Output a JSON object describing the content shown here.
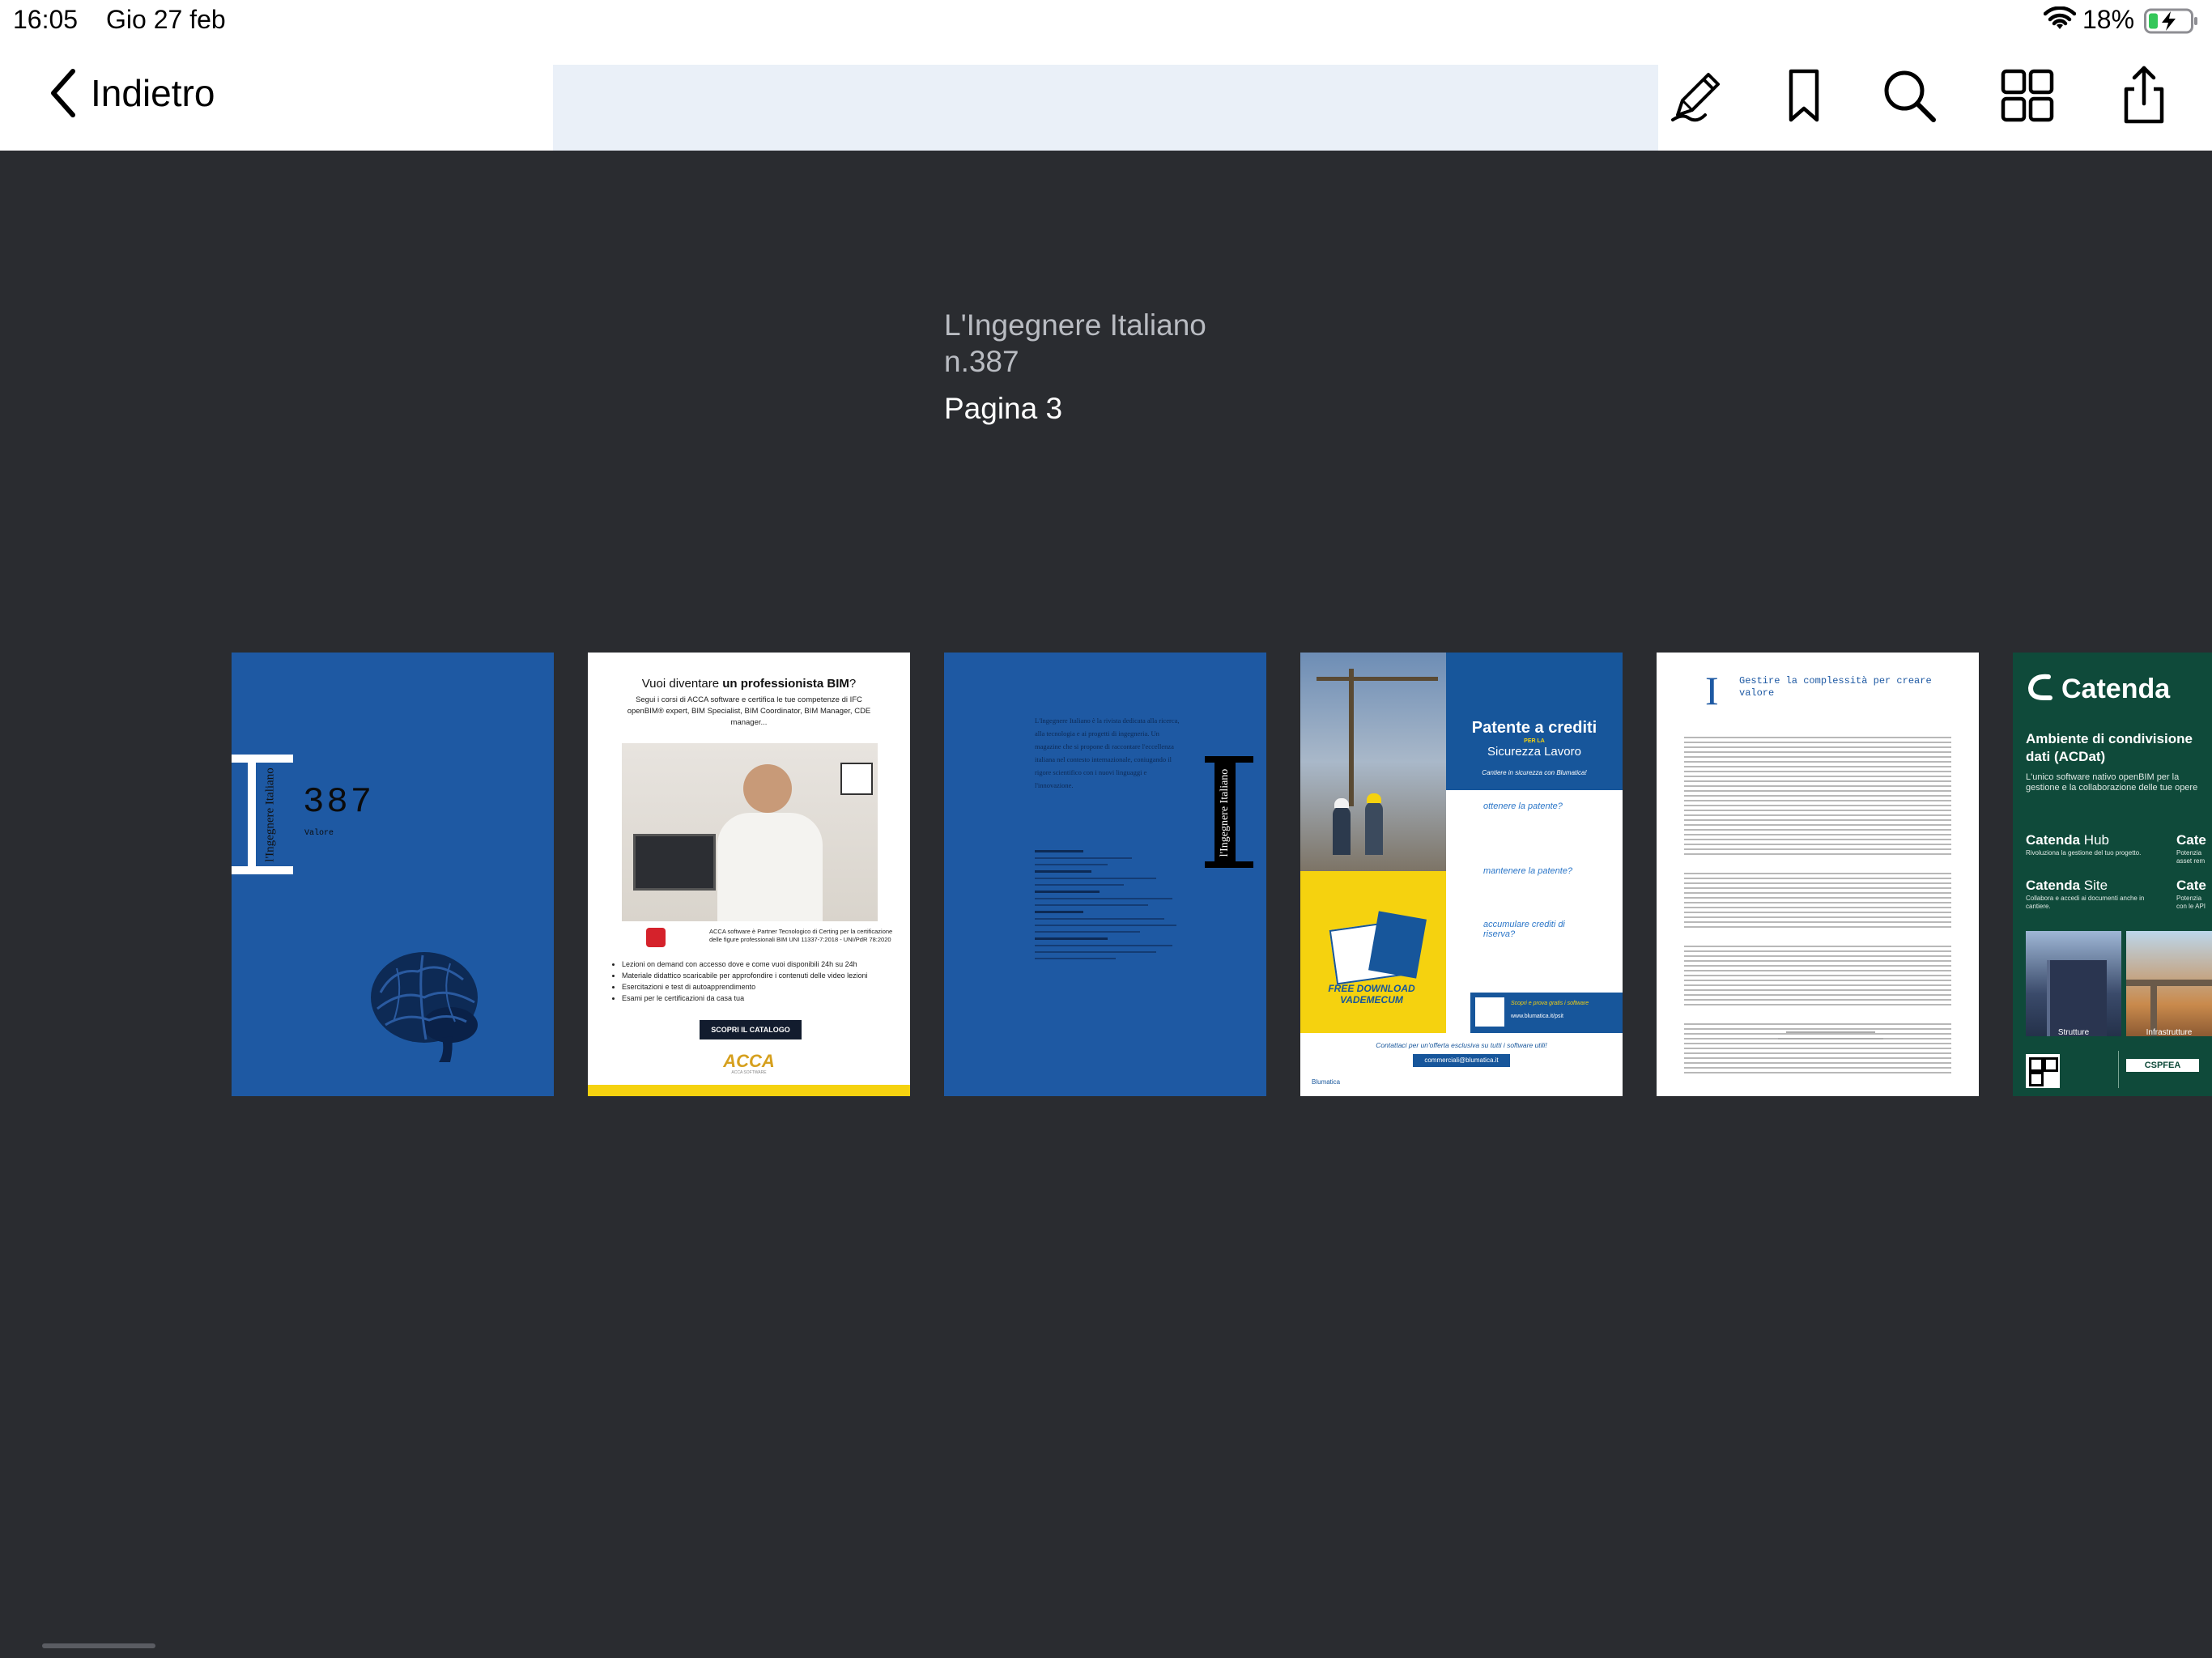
{
  "status_bar": {
    "time": "16:05",
    "date": "Gio 27 feb",
    "battery": "18%"
  },
  "toolbar": {
    "back_label": "Indietro",
    "icons": [
      "markup-pen-icon",
      "bookmark-icon",
      "search-icon",
      "grid-view-icon",
      "share-icon"
    ]
  },
  "document": {
    "title": "L'Ingegnere Italiano",
    "issue": "n.387",
    "page_label": "Pagina 3"
  },
  "thumbnails": [
    {
      "page": 1,
      "masthead": "l'Ingegnere Italiano",
      "issue_number": "387",
      "subtitle": "Valore"
    },
    {
      "page": 2,
      "headline_plain": "Vuoi diventare ",
      "headline_bold": "un professionista BIM",
      "headline_end": "?",
      "body": "Segui i corsi di ACCA software e certifica le tue competenze di IFC openBIM® expert, BIM Specialist, BIM Coordinator, BIM Manager, CDE manager...",
      "bullets": [
        "Lezioni on demand con accesso dove e come vuoi disponibili 24h su 24h",
        "Materiale didattico scaricabile per approfondire i contenuti delle video lezioni",
        "Esercitazioni e test di autoapprendimento",
        "Esami per le certificazioni da casa tua"
      ],
      "partner_text": "ACCA software è Partner Tecnologico di Certing per la certificazione delle figure professionali BIM UNI 11337-7:2018 - UNI/PdR 78:2020",
      "cta": "SCOPRI IL CATALOGO",
      "brand": "ACCA",
      "brand_sub": "ACCA SOFTWARE"
    },
    {
      "page": 3,
      "intro": "L'Ingegnere Italiano è la rivista dedicata alla ricerca, alla tecnologia e ai progetti di ingegneria. Un magazine che si propone di raccontare l'eccellenza italiana nel contesto internazionale, coniugando il rigore scientifico con i nuovi linguaggi e l'innovazione.",
      "masthead": "l'Ingegnere Italiano"
    },
    {
      "page": 4,
      "title": "Patente a crediti",
      "title_small": "PER LA",
      "title2": "Sicurezza Lavoro",
      "subtitle": "Cantiere in sicurezza con Blumatica!",
      "questions": [
        "ottenere la patente?",
        "mantenere la patente?",
        "accumulare crediti di riserva?"
      ],
      "download": "FREE DOWNLOAD VADEMECUM",
      "cta_small": "Scopri e prova gratis i software",
      "url": "www.blumatica.it/psit",
      "contact": "Contattaci per un'offerta esclusiva su tutti i software utili!",
      "email": "commerciali@blumatica.it",
      "brand": "Blumatica"
    },
    {
      "page": 5,
      "letter": "I",
      "heading": "Gestire la complessità per creare valore"
    },
    {
      "page": 6,
      "brand": "Catenda",
      "headline": "Ambiente di condivisione dati (ACDat)",
      "description": "L'unico software nativo openBIM per la gestione e la collaborazione delle tue opere",
      "products": [
        {
          "name_bold": "Catenda",
          "name": " Hub",
          "desc": "Rivoluziona la gestione del tuo progetto."
        },
        {
          "name_bold": "Catenda",
          "name": " Site",
          "desc": "Collabora e accedi ai documenti anche in cantiere."
        }
      ],
      "partial_product": "Cate",
      "partial_desc1": "Potenzia asset rem",
      "partial_desc2": "Potenzia con le API",
      "photo_labels": [
        "Strutture",
        "Infrastrutture"
      ],
      "distributor": "CSPFEA"
    }
  ],
  "colors": {
    "background": "#2a2c30",
    "cover_blue": "#1e59a3",
    "ad_yellow": "#f5d20f",
    "blumatica_blue": "#17569b",
    "catenda_green": "#0f4a3a"
  }
}
